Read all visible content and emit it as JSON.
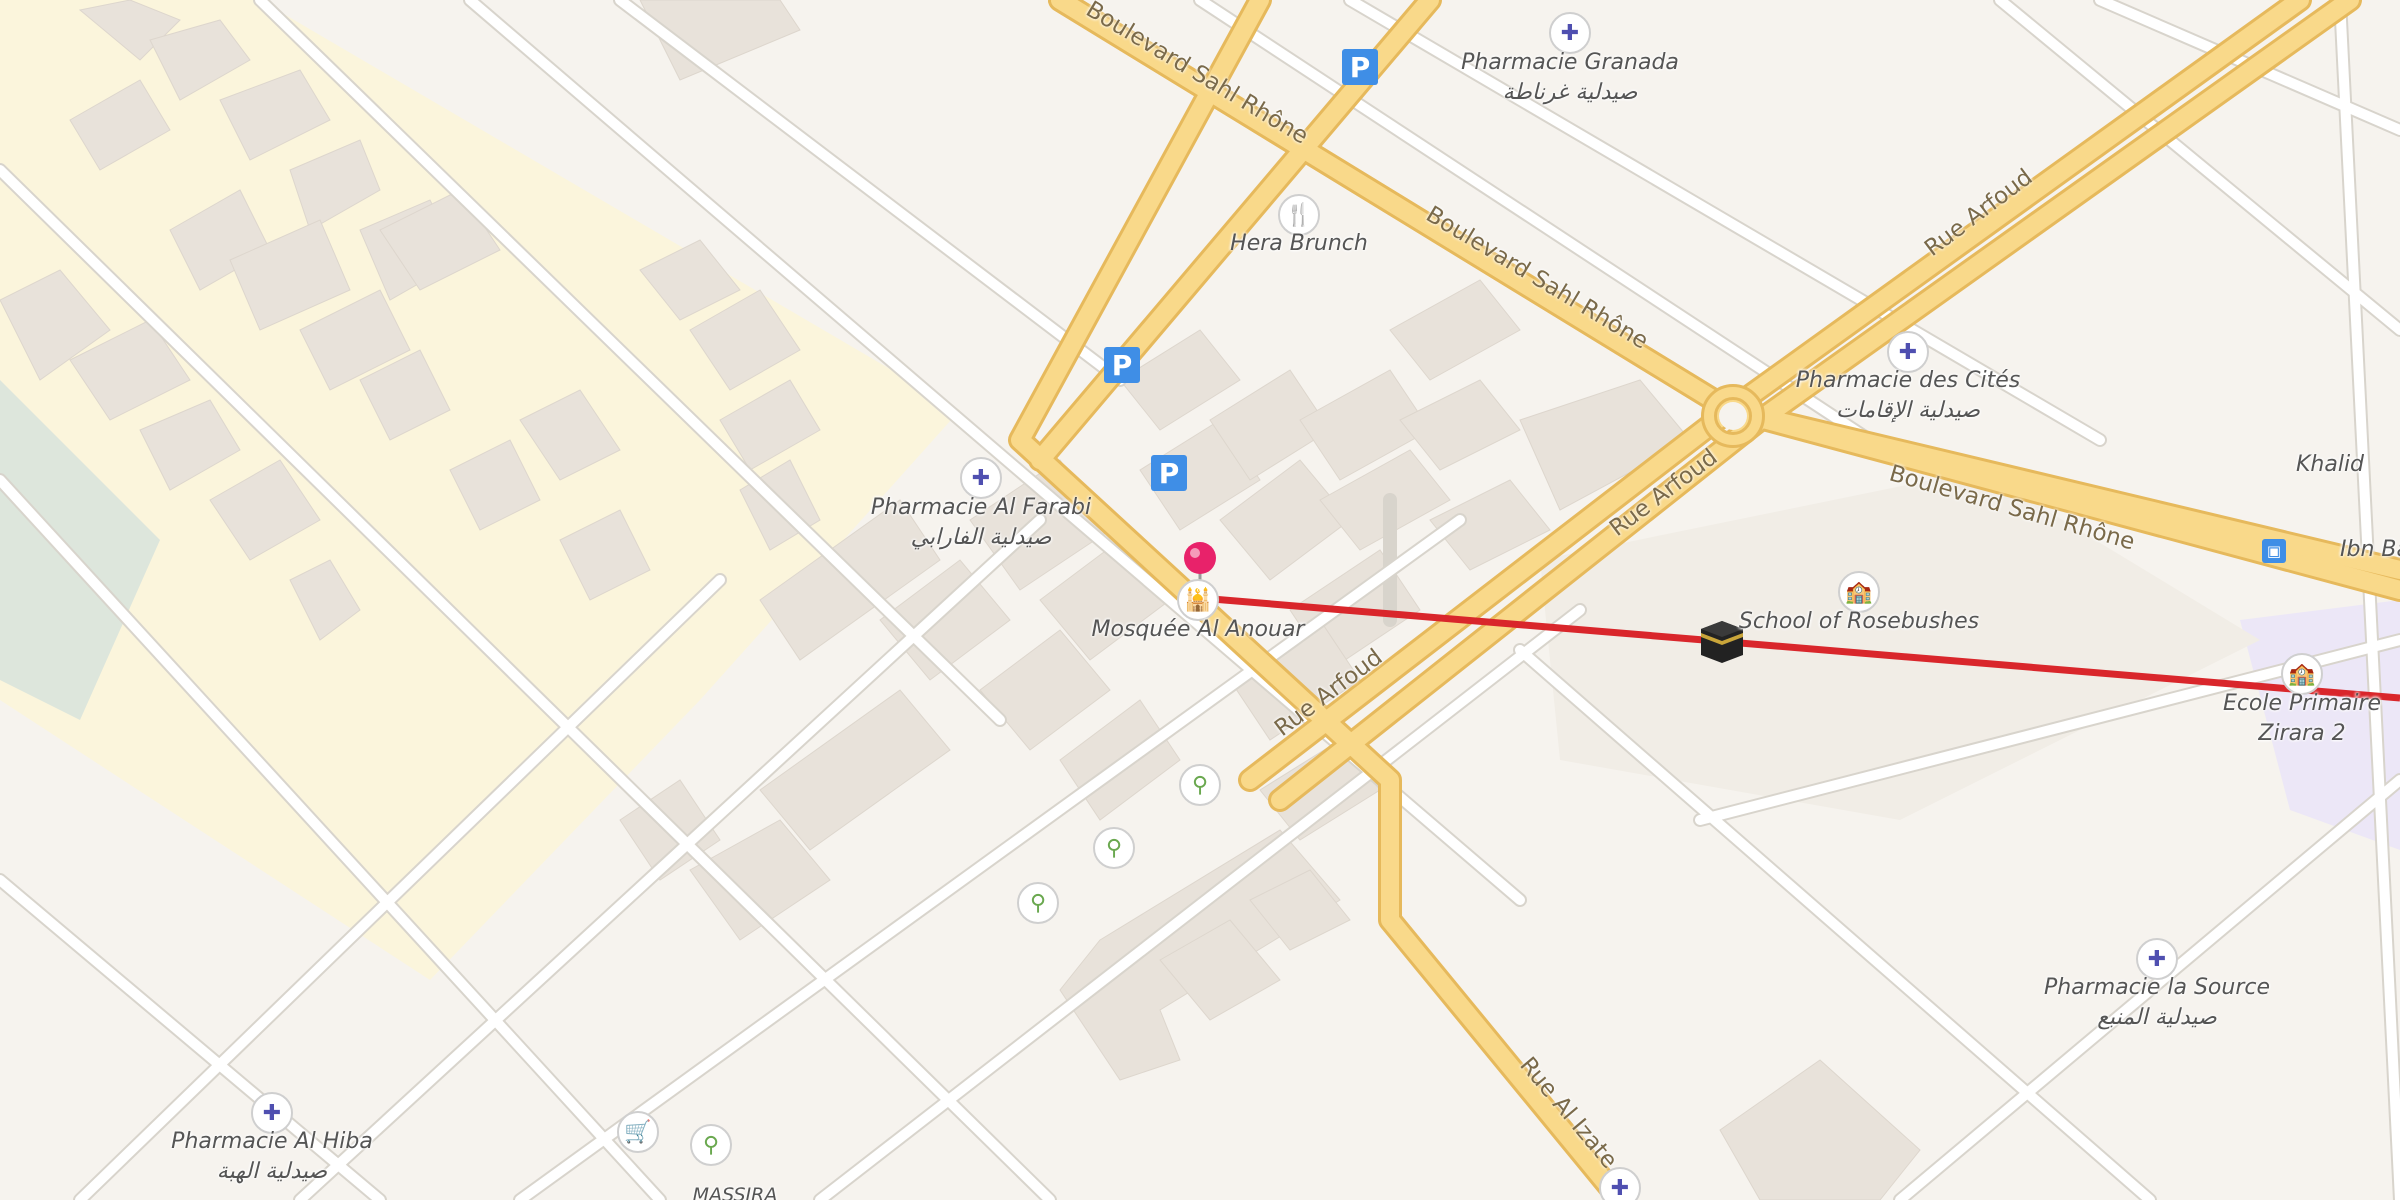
{
  "map": {
    "streets": [
      {
        "key": "bsr1",
        "text": "Boulevard Sahl Rhône"
      },
      {
        "key": "bsr2",
        "text": "Boulevard Sahl Rhône"
      },
      {
        "key": "bsr3",
        "text": "Boulevard Sahl Rhône"
      },
      {
        "key": "arf1",
        "text": "Rue Arfoud"
      },
      {
        "key": "arf2",
        "text": "Rue Arfoud"
      },
      {
        "key": "arf3",
        "text": "Rue Arfoud"
      },
      {
        "key": "izate",
        "text": "Rue Al Izate"
      }
    ],
    "places": [
      {
        "key": "granada",
        "name": "Pharmacie Granada",
        "name_ar": "صيدلية غرناطة",
        "icon": "pharmacy-icon"
      },
      {
        "key": "hera",
        "name": "Hera Brunch",
        "icon": "restaurant-icon"
      },
      {
        "key": "farabi",
        "name": "Pharmacie Al Farabi",
        "name_ar": "صيدلية الفارابي",
        "icon": "pharmacy-icon"
      },
      {
        "key": "anouar",
        "name": "Mosquée Al Anouar",
        "icon": "mosque-icon"
      },
      {
        "key": "cites",
        "name": "Pharmacie des Cités",
        "name_ar": "صيدلية الإقامات",
        "icon": "pharmacy-icon"
      },
      {
        "key": "rosebushes",
        "name": "School of Rosebushes",
        "icon": "school-icon"
      },
      {
        "key": "zirara",
        "name": "Ecole Primaire Zirara 2",
        "icon": "school-icon"
      },
      {
        "key": "source",
        "name": "Pharmacie la Source",
        "name_ar": "صيدلية المنبع",
        "icon": "pharmacy-icon"
      },
      {
        "key": "hiba",
        "name": "Pharmacie Al Hiba",
        "name_ar": "صيدلية الهبة",
        "icon": "pharmacy-icon"
      },
      {
        "key": "massira",
        "name": "MASSIRA"
      },
      {
        "key": "khalid",
        "name": "Khalid"
      },
      {
        "key": "batouta",
        "name": "Ibn Batout",
        "icon": "bus-stop-icon"
      }
    ],
    "parking_label": "P",
    "colors": {
      "background": "#f6f3ee",
      "major_road": "#f9d98a",
      "major_road_casing": "#e6b95c",
      "minor_road": "#ffffff",
      "building": "#e8e2da",
      "residential_zone": "#fbf5dc",
      "grass": "#dde6dc",
      "school_zone": "#ece7f7",
      "qibla_line": "#d9262b",
      "pin": "#e8226a"
    }
  }
}
